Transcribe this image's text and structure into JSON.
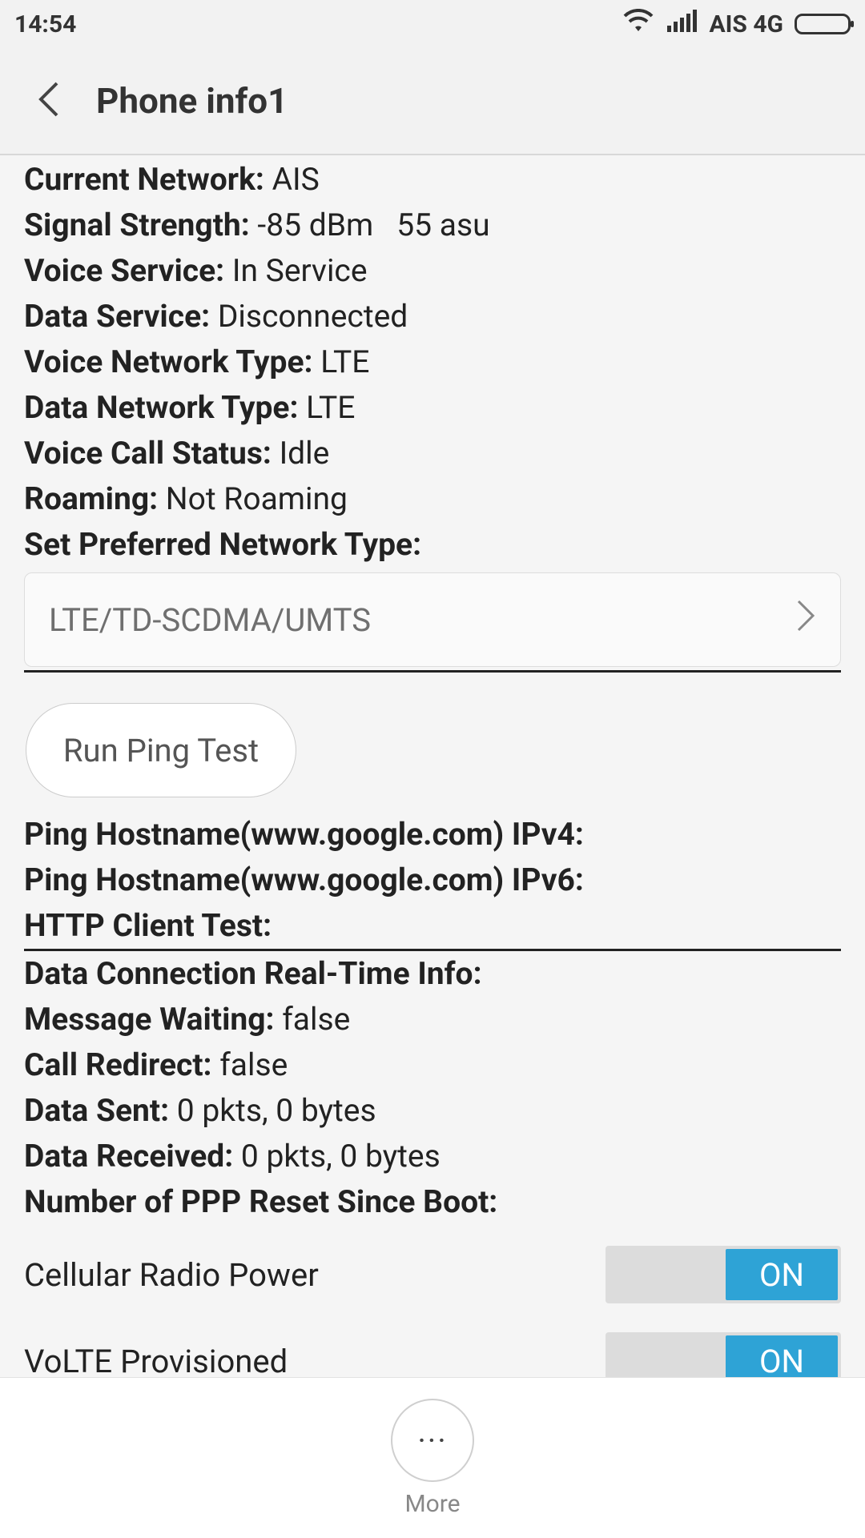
{
  "status_bar": {
    "time": "14:54",
    "carrier": "AIS 4G",
    "icons": [
      "wifi-icon",
      "signal-icon",
      "battery-icon"
    ]
  },
  "app_bar": {
    "title": "Phone info1"
  },
  "info_rows": [
    {
      "key": "Current Network:",
      "value": "AIS"
    },
    {
      "key": "Signal Strength:",
      "value": "-85 dBm   55 asu"
    },
    {
      "key": "Voice Service:",
      "value": "In Service"
    },
    {
      "key": "Data Service:",
      "value": "Disconnected"
    },
    {
      "key": "Voice Network Type:",
      "value": "LTE"
    },
    {
      "key": "Data Network Type:",
      "value": "LTE"
    },
    {
      "key": "Voice Call Status:",
      "value": "Idle"
    },
    {
      "key": "Roaming:",
      "value": "Not Roaming"
    },
    {
      "key": "Set Preferred Network Type:",
      "value": ""
    }
  ],
  "preferred_network": {
    "selected": "LTE/TD-SCDMA/UMTS"
  },
  "ping": {
    "button_label": "Run Ping Test",
    "rows": [
      {
        "key": "Ping Hostname(www.google.com) IPv4:",
        "value": ""
      },
      {
        "key": "Ping Hostname(www.google.com) IPv6:",
        "value": ""
      },
      {
        "key": "HTTP Client Test:",
        "value": ""
      }
    ]
  },
  "data_rows": [
    {
      "key": "Data Connection Real-Time Info:",
      "value": ""
    },
    {
      "key": "Message Waiting:",
      "value": "false"
    },
    {
      "key": "Call Redirect:",
      "value": "false"
    },
    {
      "key": "Data Sent:",
      "value": "0 pkts, 0 bytes"
    },
    {
      "key": "Data Received:",
      "value": "0 pkts, 0 bytes"
    },
    {
      "key": "Number of PPP Reset Since Boot:",
      "value": ""
    }
  ],
  "toggles": [
    {
      "label": "Cellular Radio Power",
      "state": "ON"
    },
    {
      "label": "VoLTE Provisioned",
      "state": "ON"
    }
  ],
  "bottom": {
    "more_icon": "···",
    "more_label": "More"
  },
  "colors": {
    "accent": "#2ea3d6",
    "background": "#f5f5f5"
  }
}
